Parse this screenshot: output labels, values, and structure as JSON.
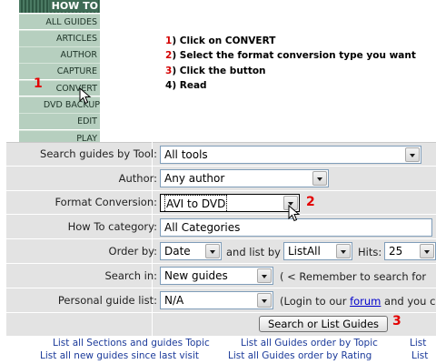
{
  "menu": {
    "header": "HOW TO",
    "items": [
      "ALL GUIDES",
      "ARTICLES",
      "AUTHOR",
      "CAPTURE",
      "CONVERT",
      "DVD BACKUP",
      "EDIT",
      "PLAY"
    ]
  },
  "steps": [
    {
      "num": "1",
      "text": ") Click on CONVERT"
    },
    {
      "num": "2",
      "text": ") Select the format conversion type you want"
    },
    {
      "num": "3",
      "text": ") Click the button"
    },
    {
      "num": "4",
      "text": ") Read"
    }
  ],
  "markers": {
    "one": "1",
    "two": "2",
    "three": "3"
  },
  "form": {
    "tool": {
      "label": "Search guides by Tool:",
      "value": "All tools"
    },
    "author": {
      "label": "Author:",
      "value": "Any author"
    },
    "format": {
      "label": "Format Conversion:",
      "value": "AVI to DVD"
    },
    "category": {
      "label": "How To category:",
      "value": "All Categories"
    },
    "order": {
      "label": "Order by:",
      "value": "Date",
      "list_by_text": "and list by",
      "list_value": "ListAll",
      "hits_text": "Hits:",
      "hits_value": "25"
    },
    "search_in": {
      "label": "Search in:",
      "value": "New guides",
      "note": "( < Remember to search for"
    },
    "personal": {
      "label": "Personal guide list:",
      "value": "N/A",
      "note_pre": "(Login to our",
      "note_link": "forum",
      "note_post": "and you c"
    },
    "button": "Search or List Guides"
  },
  "links": {
    "row1": [
      "List all Sections and guides Topic",
      "List all Guides order by Topic",
      "List"
    ],
    "row2": [
      "List all new guides since last visit",
      "List all Guides order by Rating",
      "List"
    ]
  }
}
